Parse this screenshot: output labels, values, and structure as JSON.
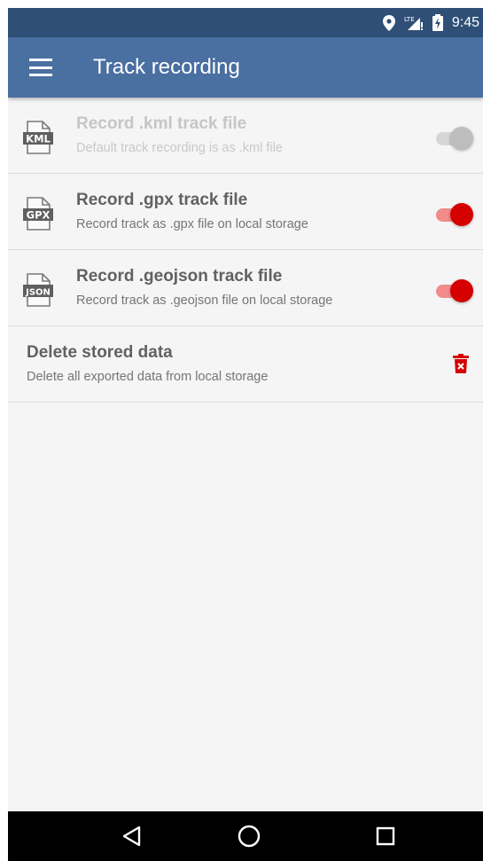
{
  "status_bar": {
    "time": "9:45",
    "icons": [
      "location-pin-icon",
      "lte-signal-icon",
      "battery-charging-icon"
    ]
  },
  "app_bar": {
    "title": "Track recording",
    "menu_icon": "hamburger-menu-icon",
    "color": "#4a6fa1"
  },
  "settings": [
    {
      "icon": "kml-file-icon",
      "icon_label": "KML",
      "title": "Record .kml track file",
      "subtitle": "Default track recording is as .kml file",
      "enabled": false,
      "switch_on": true
    },
    {
      "icon": "gpx-file-icon",
      "icon_label": "GPX",
      "title": "Record .gpx track file",
      "subtitle": "Record track as .gpx file on local storage",
      "enabled": true,
      "switch_on": true
    },
    {
      "icon": "json-file-icon",
      "icon_label": "JSON",
      "title": "Record .geojson track file",
      "subtitle": "Record track as .geojson file on local storage",
      "enabled": true,
      "switch_on": true
    }
  ],
  "delete_row": {
    "title": "Delete stored data",
    "subtitle": "Delete all exported data from local storage",
    "icon": "trash-delete-icon"
  },
  "nav_bar": {
    "buttons": [
      "back-icon",
      "home-icon",
      "recents-icon"
    ]
  },
  "colors": {
    "accent": "#d50000",
    "status_bar": "#2f4f77",
    "background": "#f5f5f5"
  }
}
